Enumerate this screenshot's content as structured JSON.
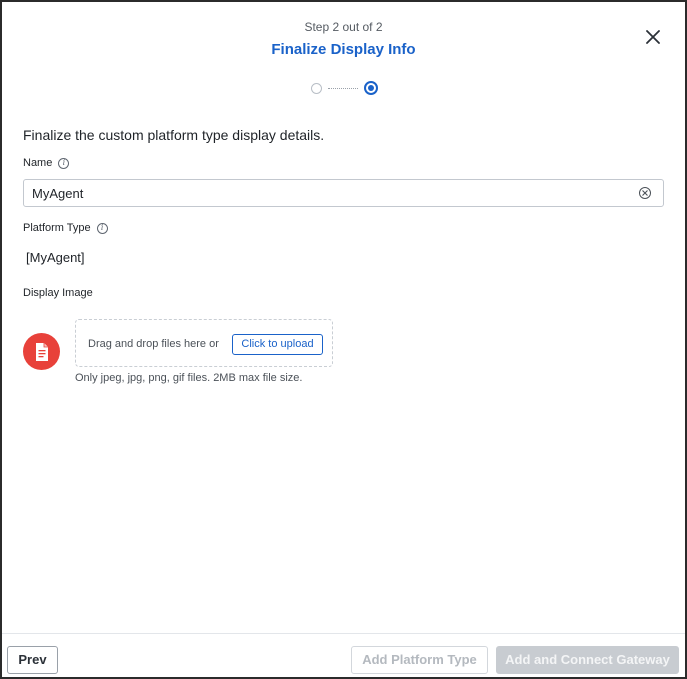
{
  "header": {
    "step_label": "Step 2 out of 2",
    "title": "Finalize Display Info"
  },
  "intro": "Finalize the custom platform type display details.",
  "fields": {
    "name_label": "Name",
    "name_value": "MyAgent",
    "platform_type_label": "Platform Type",
    "platform_type_value": "[MyAgent]",
    "display_image_label": "Display Image"
  },
  "upload": {
    "drop_text": "Drag and drop files here or",
    "button_label": "Click to upload",
    "hint": "Only jpeg, jpg, png, gif files. 2MB max file size."
  },
  "footer": {
    "prev_label": "Prev",
    "add_platform_type_label": "Add Platform Type",
    "add_connect_label": "Add and Connect Gateway"
  },
  "icons": {
    "close": "close-icon",
    "info": "info-icon",
    "clear": "clear-icon",
    "document": "document-icon"
  },
  "colors": {
    "accent": "#1a62c9",
    "image_badge": "#e8413a",
    "disabled": "#c8ccd1"
  }
}
